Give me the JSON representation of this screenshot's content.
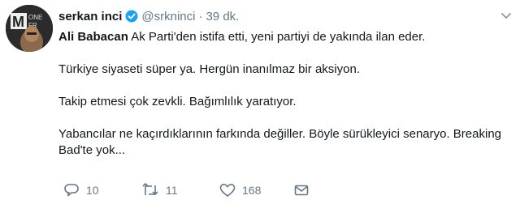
{
  "tweet": {
    "author_name": "serkan inci",
    "handle": "@srkninci",
    "separator": "·",
    "time": "39 dk.",
    "avatar_badge": "MONEY",
    "paragraphs": [
      {
        "mention": "Ali Babacan",
        "text": " Ak Parti'den istifa etti, yeni partiyi de yakında ilan eder."
      },
      {
        "mention": "",
        "text": "Türkiye siyaseti süper ya. Hergün inanılmaz bir aksiyon."
      },
      {
        "mention": "",
        "text": "Takip etmesi çok zevkli. Bağımlılık yaratıyor."
      },
      {
        "mention": "",
        "text": "Yabancılar ne kaçırdıklarının farkında değiller. Böyle sürükleyici senaryo. Breaking Bad'te yok..."
      }
    ],
    "actions": {
      "reply_count": "10",
      "retweet_count": "11",
      "like_count": "168"
    }
  },
  "colors": {
    "text": "#14171a",
    "muted": "#657786",
    "verified": "#1da1f2"
  },
  "icons": {
    "verified": "verified-badge-icon",
    "caret": "chevron-down-icon",
    "reply": "reply-icon",
    "retweet": "retweet-icon",
    "like": "heart-icon",
    "dm": "direct-message-icon"
  }
}
